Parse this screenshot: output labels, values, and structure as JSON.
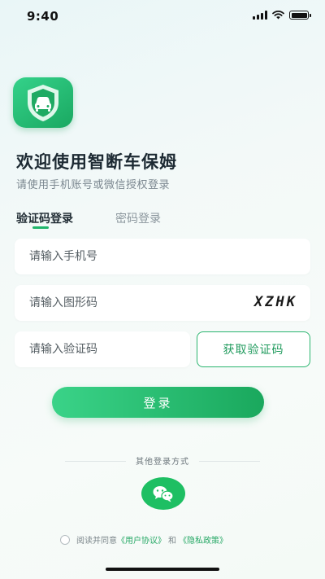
{
  "status_bar": {
    "time": "9:40"
  },
  "app": {
    "icon": "car-shield-icon",
    "brand_color": "#1fb56b"
  },
  "header": {
    "title": "欢迎使用智断车保姆",
    "subtitle": "请使用手机账号或微信授权登录"
  },
  "tabs": [
    {
      "label": "验证码登录",
      "active": true
    },
    {
      "label": "密码登录",
      "active": false
    }
  ],
  "form": {
    "phone": {
      "placeholder": "请输入手机号",
      "value": ""
    },
    "captcha": {
      "placeholder": "请输入图形码",
      "value": "",
      "image_text": "XZHK"
    },
    "sms_code": {
      "placeholder": "请输入验证码",
      "value": ""
    },
    "get_code_label": "获取验证码",
    "login_label": "登录"
  },
  "other_login": {
    "label": "其他登录方式",
    "wechat_icon": "wechat-icon"
  },
  "agreement": {
    "prefix": "阅读并同意",
    "user_agreement": "《用户协议》",
    "conjunction": "和",
    "privacy_policy": "《隐私政策》",
    "checked": false
  }
}
